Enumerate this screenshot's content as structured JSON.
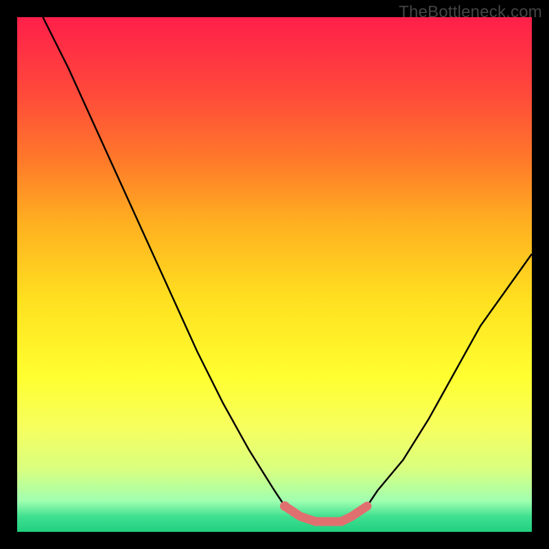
{
  "watermark": "TheBottleneck.com",
  "chart_data": {
    "type": "line",
    "title": "",
    "xlabel": "",
    "ylabel": "",
    "xlim": [
      0,
      100
    ],
    "ylim": [
      0,
      100
    ],
    "series": [
      {
        "name": "bottleneck-curve",
        "color": "#000000",
        "x": [
          5,
          10,
          15,
          20,
          25,
          30,
          35,
          40,
          45,
          50,
          52,
          55,
          58,
          60,
          63,
          65,
          68,
          70,
          75,
          80,
          85,
          90,
          95,
          100
        ],
        "y": [
          100,
          90,
          79,
          68,
          57,
          46,
          35,
          25,
          16,
          8,
          5,
          3,
          2,
          2,
          2,
          3,
          5,
          8,
          14,
          22,
          31,
          40,
          47,
          54
        ]
      },
      {
        "name": "optimal-range-highlight",
        "color": "#e07070",
        "x": [
          52,
          55,
          58,
          60,
          63,
          65,
          68
        ],
        "y": [
          5,
          3,
          2,
          2,
          2,
          3,
          5
        ]
      }
    ],
    "annotations": []
  }
}
